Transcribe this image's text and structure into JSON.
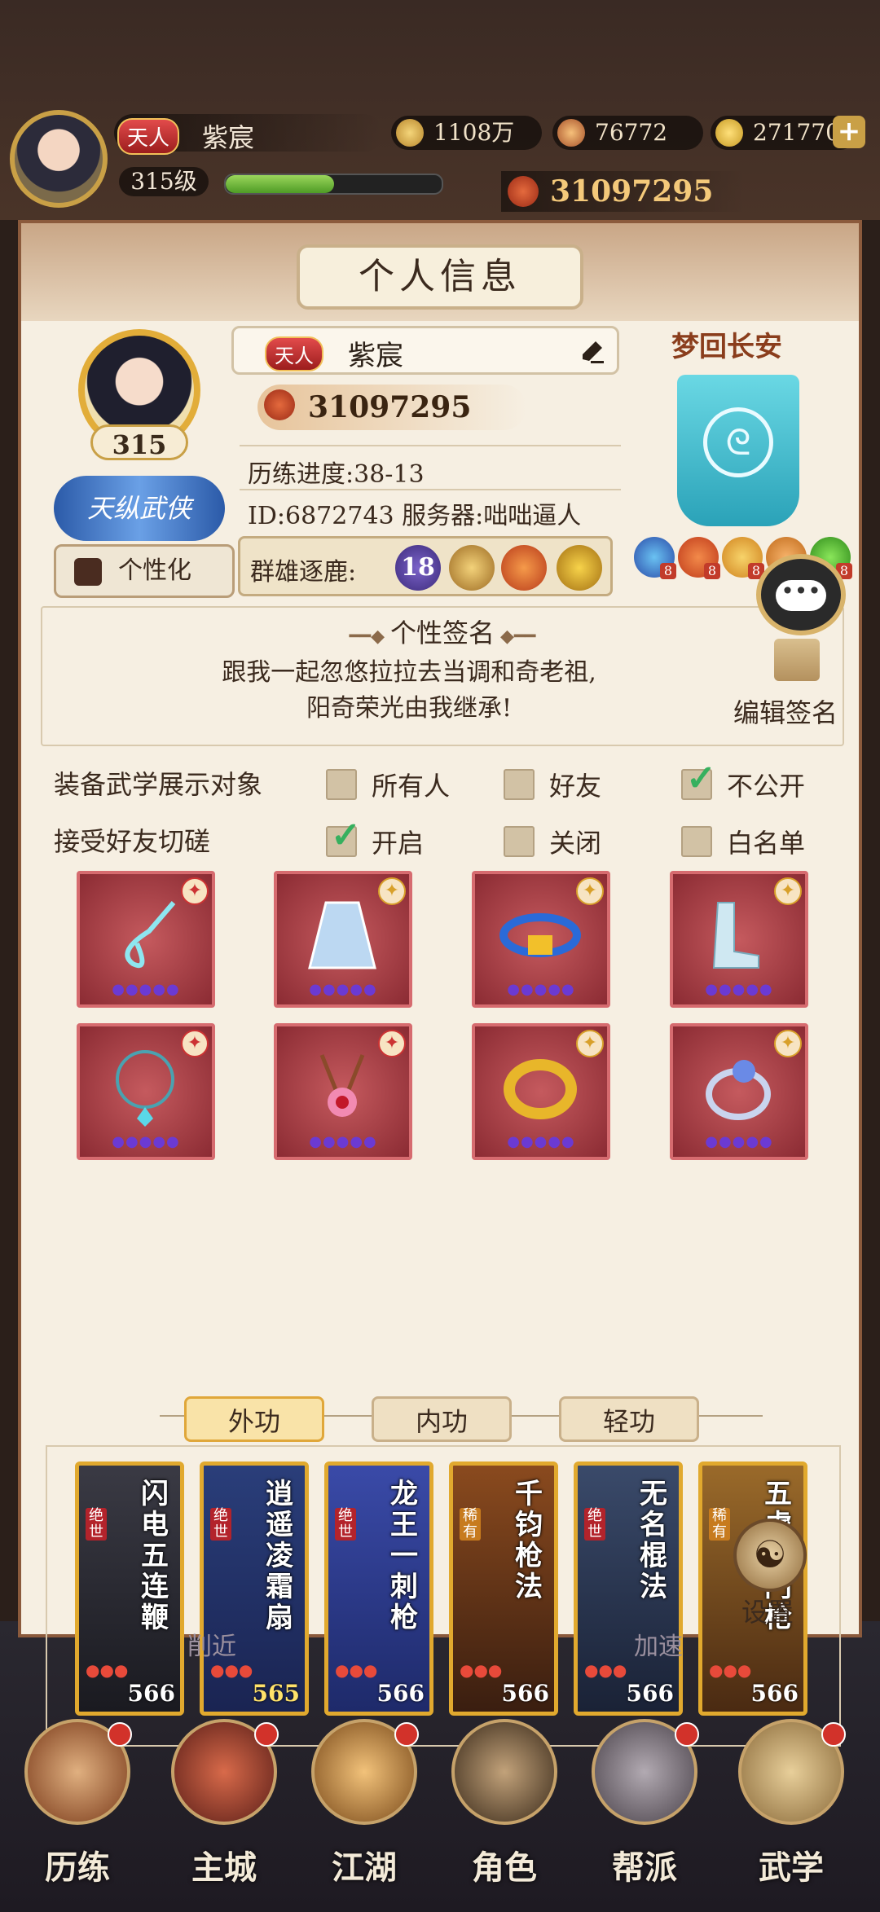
{
  "top_bar": {
    "rank_badge": "天人",
    "player_name": "紫宸",
    "level": "315级",
    "xp_fraction": 0.5,
    "copper": "1108万",
    "ingot_yuanbao": "76772",
    "gold": "271770",
    "power": "31097295"
  },
  "panel": {
    "title": "个人信息",
    "level": "315",
    "logo_text": "天纵武侠",
    "personalize_label": "个性化",
    "name_rank_badge": "天人",
    "name": "紫宸",
    "power": "31097295",
    "progress": "历练进度:38-13",
    "id_server": "ID:6872743   服务器:咄咄逼人",
    "arena_label": "群雄逐鹿:",
    "arena_rank": "18",
    "guild_name": "梦回长安",
    "guild_gem_count": "8"
  },
  "signature": {
    "title": "个性签名",
    "line1": "跟我一起忽悠拉拉去当调和奇老祖,",
    "line2": "阳奇荣光由我继承!",
    "edit_label": "编辑签名"
  },
  "options": {
    "row1_label": "装备武学展示对象",
    "row1_opt1": "所有人",
    "row1_opt2": "好友",
    "row1_opt3": "不公开",
    "row2_label": "接受好友切磋",
    "row2_opt1": "开启",
    "row2_opt2": "关闭",
    "row2_opt3": "白名单"
  },
  "tabs": {
    "outer": "外功",
    "inner": "内功",
    "light": "轻功"
  },
  "skills": [
    {
      "name": "闪电五连鞭",
      "tag": "绝世",
      "level": "566"
    },
    {
      "name": "逍遥凌霜扇",
      "tag": "绝世",
      "level": "565"
    },
    {
      "name": "龙王一刺枪",
      "tag": "绝世",
      "level": "566"
    },
    {
      "name": "千钧枪法",
      "tag": "稀有",
      "level": "566"
    },
    {
      "name": "无名棍法",
      "tag": "绝世",
      "level": "566"
    },
    {
      "name": "五虎断门枪",
      "tag": "稀有",
      "level": "566"
    }
  ],
  "settings_label": "设置",
  "bg_partial": {
    "left": "削近",
    "right": "加速"
  },
  "nav": [
    {
      "label": "历练"
    },
    {
      "label": "主城"
    },
    {
      "label": "江湖"
    },
    {
      "label": "角色"
    },
    {
      "label": "帮派"
    },
    {
      "label": "武学"
    }
  ],
  "colors": {
    "panel_bg": "#f6efe2",
    "accent_gold": "#e1a92e",
    "equip_red": "#8b2b33",
    "check_green": "#36b05e"
  }
}
